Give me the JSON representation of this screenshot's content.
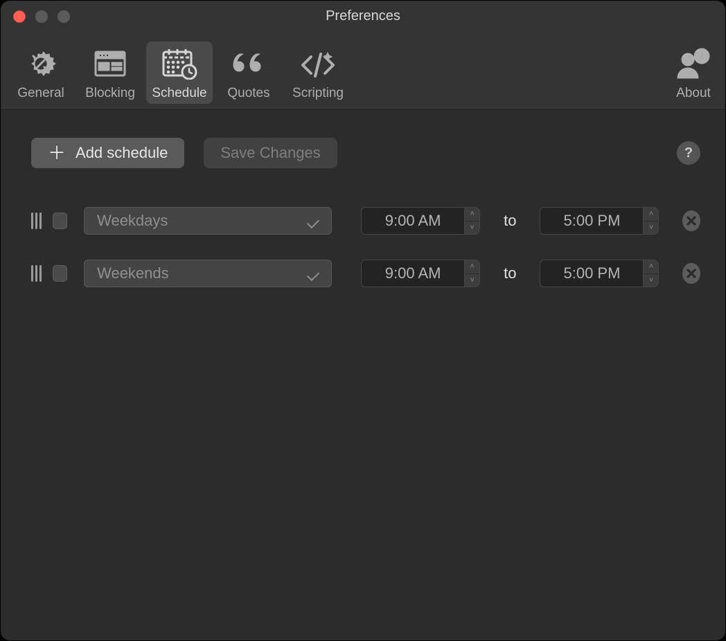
{
  "window": {
    "title": "Preferences"
  },
  "toolbar": {
    "items": {
      "general": {
        "label": "General"
      },
      "blocking": {
        "label": "Blocking"
      },
      "schedule": {
        "label": "Schedule"
      },
      "quotes": {
        "label": "Quotes"
      },
      "scripting": {
        "label": "Scripting"
      },
      "about": {
        "label": "About"
      }
    },
    "active": "schedule"
  },
  "buttons": {
    "add_schedule": "Add schedule",
    "save_changes": "Save Changes",
    "help": "?"
  },
  "rows": [
    {
      "dayset": "Weekdays",
      "start": "9:00 AM",
      "to": "to",
      "end": "5:00 PM"
    },
    {
      "dayset": "Weekends",
      "start": "9:00 AM",
      "to": "to",
      "end": "5:00 PM"
    }
  ]
}
